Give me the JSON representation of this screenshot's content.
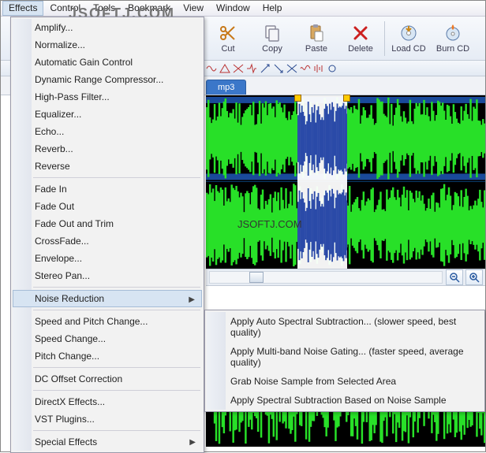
{
  "menubar": [
    "Effects",
    "Control",
    "Tools",
    "Bookmark",
    "View",
    "Window",
    "Help"
  ],
  "watermark": "JSOFTJ.COM",
  "watermark2": "JSOFTJ.COM",
  "toolbar": {
    "cut": "Cut",
    "copy": "Copy",
    "paste": "Paste",
    "delete": "Delete",
    "loadcd": "Load CD",
    "burncd": "Burn CD"
  },
  "tab": {
    "filename": "mp3"
  },
  "effects_menu": {
    "items_a": [
      "Amplify...",
      "Normalize...",
      "Automatic Gain Control",
      "Dynamic Range Compressor...",
      "High-Pass Filter...",
      "Equalizer...",
      "Echo...",
      "Reverb...",
      "Reverse"
    ],
    "items_b": [
      "Fade In",
      "Fade Out",
      "Fade Out and Trim",
      "CrossFade...",
      "Envelope...",
      "Stereo Pan..."
    ],
    "noise_reduction": "Noise Reduction",
    "items_c": [
      "Speed and Pitch Change...",
      "Speed Change...",
      "Pitch Change..."
    ],
    "dc_offset": "DC Offset Correction",
    "items_d": [
      "DirectX Effects...",
      "VST Plugins..."
    ],
    "special": "Special Effects"
  },
  "noise_submenu": [
    "Apply Auto Spectral Subtraction... (slower speed, best quality)",
    "Apply Multi-band Noise Gating... (faster speed, average quality)",
    "Grab Noise Sample from Selected Area",
    "Apply Spectral Subtraction Based on Noise Sample"
  ]
}
